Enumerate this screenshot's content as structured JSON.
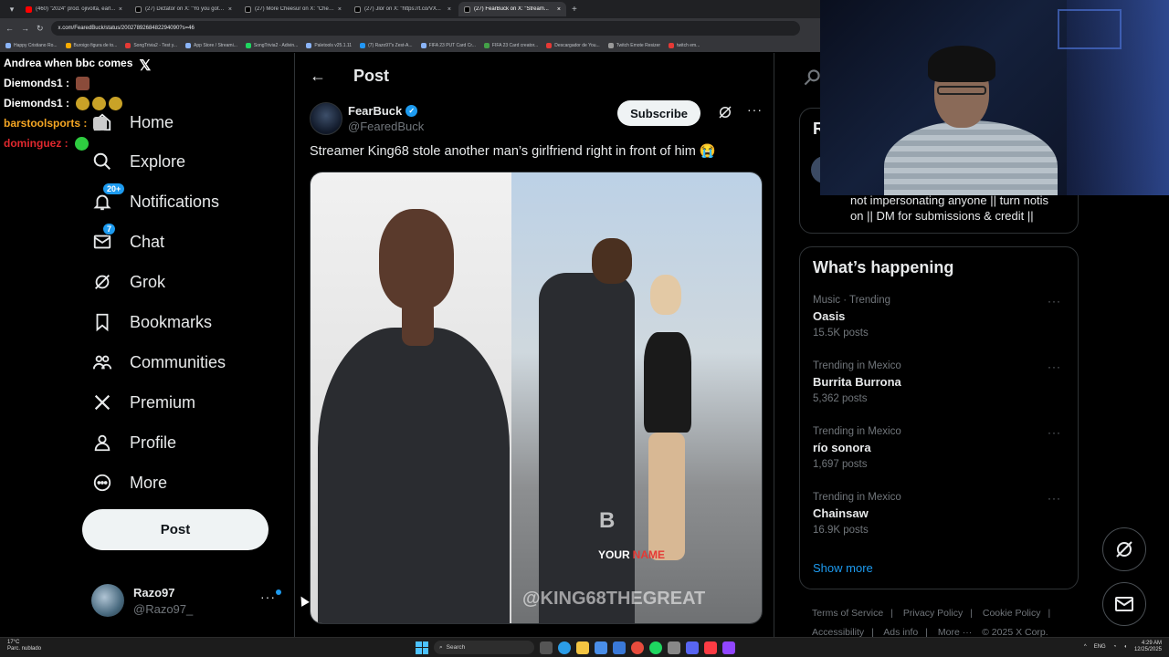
{
  "browser": {
    "tabs": [
      {
        "title": "(460) \"2024\" prod. ojivolta, earl...",
        "favicon": "youtube-icon",
        "active": false
      },
      {
        "title": "(27) Dictator on X: \"Yo you gotta...",
        "favicon": "x-logo-icon",
        "active": false
      },
      {
        "title": "(27) More Cheesur on X: \"Chee...",
        "favicon": "x-logo-icon",
        "active": false
      },
      {
        "title": "(27) Jlor on X: \"https://t.co/VX...",
        "favicon": "x-logo-icon",
        "active": false
      },
      {
        "title": "(27) FearBuck on X: \"Stream...",
        "favicon": "x-logo-icon",
        "active": true
      }
    ],
    "url": "x.com/FearedBuck/status/2002789268482294090?s=46",
    "bookmarks": [
      "Happy Cristiano Ro...",
      "Buroigo figura de to...",
      "SongTrivia2 - Test y...",
      "App Store / Streami...",
      "SongTrivia2 - Adivin...",
      "Paletools v25.1.11",
      "(7) Razo97's Zest-A...",
      "FIFA 23 PUT Card Cr...",
      "FIFA 23 Card creator...",
      "Descargador de You...",
      "Twitch Emote Resizer",
      "twitch em..."
    ]
  },
  "stream_chat": [
    {
      "user": "Andrea when bbc comes",
      "user_color": "#ffffff",
      "message": "",
      "emotes": [
        "x-logo-emote"
      ]
    },
    {
      "user": "Diemonds1 :",
      "user_color": "#ffffff",
      "message": "",
      "emotes": [
        "tiles-emote"
      ]
    },
    {
      "user": "Diemonds1 :",
      "user_color": "#ffffff",
      "message": "",
      "emotes": [
        "money-bag-emote",
        "money-bag-emote",
        "money-bag-emote"
      ]
    },
    {
      "user": "barstoolsports :",
      "user_color": "#f5a623",
      "message": "",
      "emotes": [
        "hand-emote"
      ]
    },
    {
      "user": "dominguez :",
      "user_color": "#e0282e",
      "message": "",
      "emotes": [
        "green-emote"
      ]
    }
  ],
  "sidebar": {
    "items": [
      {
        "label": "Home",
        "icon": "home-icon"
      },
      {
        "label": "Explore",
        "icon": "search-icon"
      },
      {
        "label": "Notifications",
        "icon": "bell-icon",
        "badge": "20+"
      },
      {
        "label": "Chat",
        "icon": "envelope-icon",
        "badge": "7"
      },
      {
        "label": "Grok",
        "icon": "grok-icon"
      },
      {
        "label": "Bookmarks",
        "icon": "bookmark-icon"
      },
      {
        "label": "Communities",
        "icon": "communities-icon"
      },
      {
        "label": "Premium",
        "icon": "x-logo-icon"
      },
      {
        "label": "Profile",
        "icon": "person-icon"
      },
      {
        "label": "More",
        "icon": "more-circle-icon"
      }
    ],
    "post_label": "Post",
    "account": {
      "name": "Razo97",
      "handle": "@Razo97_"
    }
  },
  "main": {
    "header_title": "Post",
    "tweet": {
      "author_name": "FearBuck",
      "author_handle": "@FearedBuck",
      "verified": true,
      "subscribe_label": "Subscribe",
      "text": "Streamer King68 stole another man’s girlfriend right in front of him 😭",
      "media_watermark": "@KING68THEGREAT",
      "media_logo": "B",
      "media_caption_prefix": "YOUR",
      "media_caption_suffix": "NAME"
    }
  },
  "right": {
    "card_top_letter": "R",
    "bio": "not impersonating anyone || turn notis on || DM for submissions & credit ||",
    "whats_happening_title": "What’s happening",
    "trends": [
      {
        "context": "Music · Trending",
        "title": "Oasis",
        "count": "15.5K posts"
      },
      {
        "context": "Trending in Mexico",
        "title": "Burrita Burrona",
        "count": "5,362 posts"
      },
      {
        "context": "Trending in Mexico",
        "title": "río sonora",
        "count": "1,697 posts"
      },
      {
        "context": "Trending in Mexico",
        "title": "Chainsaw",
        "count": "16.9K posts"
      }
    ],
    "show_more": "Show more",
    "footer": [
      "Terms of Service",
      "|",
      "Privacy Policy",
      "|",
      "Cookie Policy",
      "|",
      "Accessibility",
      "|",
      "Ads info",
      "|",
      "More ···",
      "© 2025 X Corp."
    ]
  },
  "taskbar": {
    "weather_temp": "17°C",
    "weather_desc": "Parc. nublado",
    "search_label": "Search",
    "lang": "ENG",
    "time": "4:29 AM",
    "date": "12/25/2025"
  },
  "colors": {
    "accent": "#1d9bf0",
    "background": "#000000",
    "text": "#e7e9ea",
    "muted": "#71767b"
  }
}
